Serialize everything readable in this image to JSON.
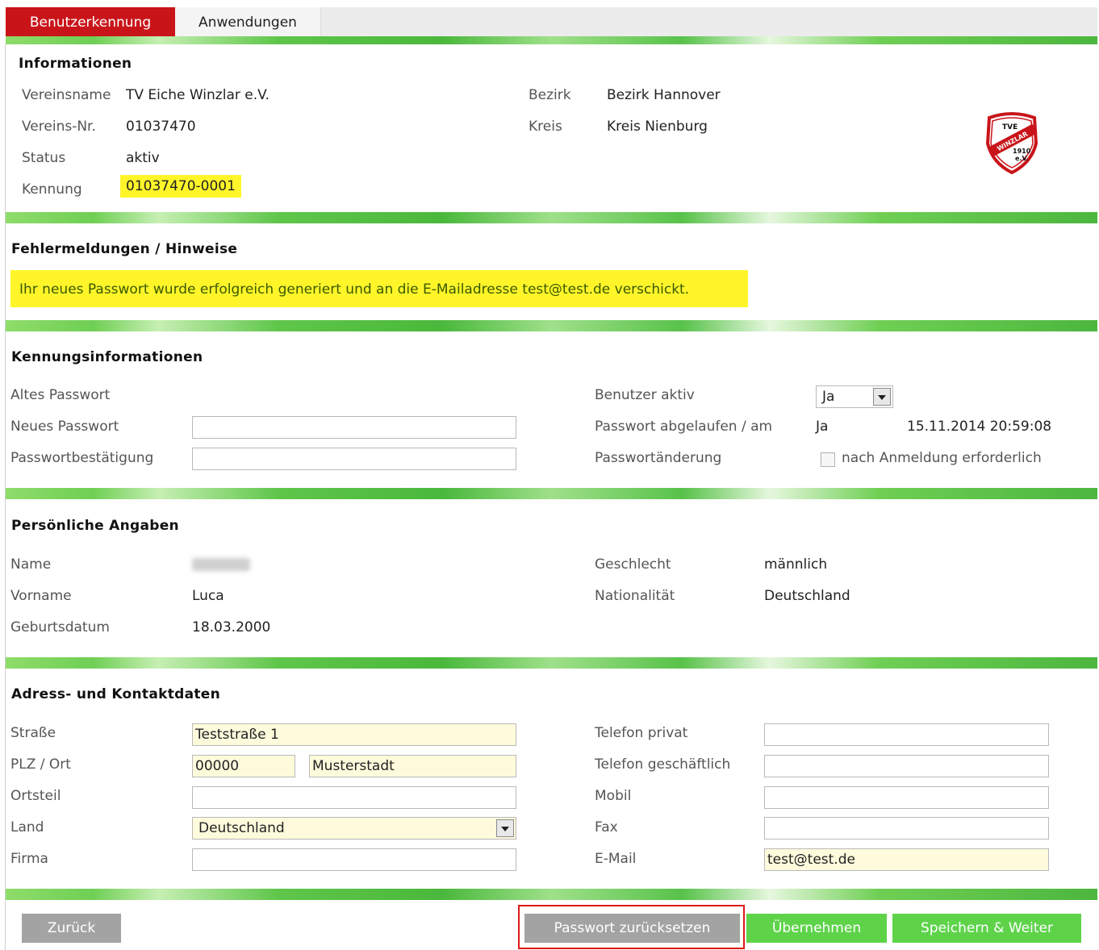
{
  "tabs": [
    {
      "label": "Benutzerkennung",
      "active": true
    },
    {
      "label": "Anwendungen",
      "active": false
    }
  ],
  "info": {
    "title": "Informationen",
    "vereinsname_label": "Vereinsname",
    "vereinsname": "TV Eiche Winzlar e.V.",
    "vereinsnr_label": "Vereins-Nr.",
    "vereinsnr": "01037470",
    "status_label": "Status",
    "status": "aktiv",
    "kennung_label": "Kennung",
    "kennung": "01037470-0001",
    "bezirk_label": "Bezirk",
    "bezirk": "Bezirk Hannover",
    "kreis_label": "Kreis",
    "kreis": "Kreis Nienburg",
    "logo": {
      "line1": "TVE",
      "line2": "WINZLAR",
      "line3": "1910",
      "line4": "e.V."
    }
  },
  "messages": {
    "title": "Fehlermeldungen / Hinweise",
    "text": "Ihr neues Passwort wurde erfolgreich generiert und an die E-Mailadresse test@test.de verschickt."
  },
  "credentials": {
    "title": "Kennungsinformationen",
    "old_pw_label": "Altes Passwort",
    "new_pw_label": "Neues Passwort",
    "confirm_pw_label": "Passwortbestätigung",
    "user_active_label": "Benutzer aktiv",
    "user_active_value": "Ja",
    "pw_expired_label": "Passwort abgelaufen / am",
    "pw_expired_value": "Ja",
    "pw_expired_date": "15.11.2014 20:59:08",
    "pw_change_label": "Passwortänderung",
    "pw_change_checkbox": "nach Anmeldung erforderlich"
  },
  "personal": {
    "title": "Persönliche Angaben",
    "name_label": "Name",
    "vorname_label": "Vorname",
    "vorname": "Luca",
    "geburtsdatum_label": "Geburtsdatum",
    "geburtsdatum": "18.03.2000",
    "geschlecht_label": "Geschlecht",
    "geschlecht": "männlich",
    "nationalitaet_label": "Nationalität",
    "nationalitaet": "Deutschland"
  },
  "address": {
    "title": "Adress- und Kontaktdaten",
    "strasse_label": "Straße",
    "strasse": "Teststraße 1",
    "plzort_label": "PLZ / Ort",
    "plz": "00000",
    "ort": "Musterstadt",
    "ortsteil_label": "Ortsteil",
    "ortsteil": "",
    "land_label": "Land",
    "land": "Deutschland",
    "firma_label": "Firma",
    "firma": "",
    "tel_privat_label": "Telefon privat",
    "tel_privat": "",
    "tel_geschaeft_label": "Telefon geschäftlich",
    "tel_geschaeft": "",
    "mobil_label": "Mobil",
    "mobil": "",
    "fax_label": "Fax",
    "fax": "",
    "email_label": "E-Mail",
    "email": "test@test.de"
  },
  "buttons": {
    "back": "Zurück",
    "reset_pw": "Passwort zurücksetzen",
    "apply": "Übernehmen",
    "save_next": "Speichern & Weiter"
  },
  "colors": {
    "tab_active": "#c9151a",
    "highlight": "#fff529",
    "button_green": "#5ed34a",
    "button_gray": "#a3a3a3"
  }
}
